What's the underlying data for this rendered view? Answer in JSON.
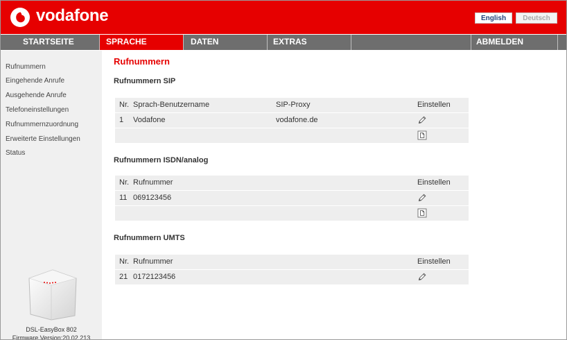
{
  "header": {
    "brand": "vodafone",
    "lang_en": "English",
    "lang_de": "Deutsch",
    "brand_color": "#e60000"
  },
  "nav": {
    "items": [
      {
        "label": "STARTSEITE",
        "active": false
      },
      {
        "label": "SPRACHE",
        "active": true
      },
      {
        "label": "DATEN",
        "active": false
      },
      {
        "label": "EXTRAS",
        "active": false
      },
      {
        "label": "",
        "active": false
      },
      {
        "label": "ABMELDEN",
        "active": false
      }
    ]
  },
  "sidebar": {
    "items": [
      {
        "label": "Rufnummern"
      },
      {
        "label": "Eingehende Anrufe"
      },
      {
        "label": "Ausgehende Anrufe"
      },
      {
        "label": "Telefoneinstellungen"
      },
      {
        "label": "Rufnummernzuordnung"
      },
      {
        "label": "Erweiterte Einstellungen"
      },
      {
        "label": "Status"
      }
    ],
    "device_name": "DSL-EasyBox 802",
    "firmware": "Firmware Version:20.02.213"
  },
  "main": {
    "title": "Rufnummern",
    "sip": {
      "title": "Rufnummern SIP",
      "headers": [
        "Nr.",
        "Sprach-Benutzername",
        "SIP-Proxy",
        "Einstellen"
      ],
      "rows": [
        {
          "nr": "1",
          "name": "Vodafone",
          "proxy": "vodafone.de"
        }
      ]
    },
    "isdn": {
      "title": "Rufnummern ISDN/analog",
      "headers": [
        "Nr.",
        "Rufnummer",
        "Einstellen"
      ],
      "rows": [
        {
          "nr": "11",
          "number": "069123456"
        }
      ]
    },
    "umts": {
      "title": "Rufnummern UMTS",
      "headers": [
        "Nr.",
        "Rufnummer",
        "Einstellen"
      ],
      "rows": [
        {
          "nr": "21",
          "number": "0172123456"
        }
      ]
    }
  },
  "icons": {
    "edit": "pencil-icon",
    "new": "new-document-icon",
    "logo": "vodafone-speechmark-logo"
  }
}
